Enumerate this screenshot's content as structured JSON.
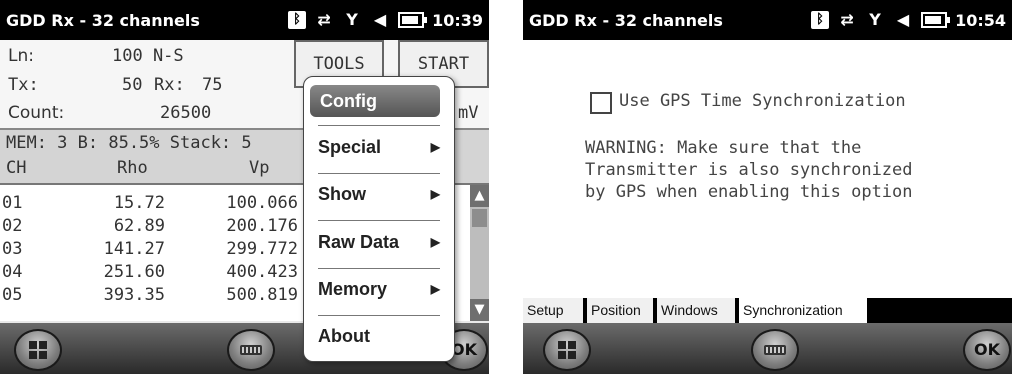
{
  "left": {
    "title": "GDD Rx - 32 channels",
    "time": "10:39",
    "icons": [
      "bluetooth-icon",
      "sync-icon",
      "no-signal-icon",
      "volume-icon",
      "battery-icon"
    ],
    "ln_label": "Ln:",
    "ln_value": "100 N-S",
    "tx_label": "Tx:",
    "tx_value": "50",
    "rx_label": "Rx:",
    "rx_value": "75",
    "count_label": "Count:",
    "count_value": "26500",
    "unit": "mV",
    "tools_button": "TOOLS",
    "start_button": "START",
    "stats_line": "MEM: 3 B: 85.5% Stack: 5",
    "col_ch": "CH",
    "col_rho": "Rho",
    "col_vp": "Vp",
    "rows": [
      {
        "ch": "01",
        "rho": "15.72",
        "vp": "100.066"
      },
      {
        "ch": "02",
        "rho": "62.89",
        "vp": "200.176"
      },
      {
        "ch": "03",
        "rho": "141.27",
        "vp": "299.772"
      },
      {
        "ch": "04",
        "rho": "251.60",
        "vp": "400.423"
      },
      {
        "ch": "05",
        "rho": "393.35",
        "vp": "500.819"
      }
    ],
    "menu": {
      "config": "Config",
      "special": "Special",
      "show": "Show",
      "raw_data": "Raw Data",
      "memory": "Memory",
      "about": "About"
    },
    "ok_label": "OK"
  },
  "right": {
    "title": "GDD Rx - 32 channels",
    "time": "10:54",
    "checkbox_label": "Use GPS Time Synchronization",
    "warning_lines": [
      "WARNING: Make sure that the",
      "Transmitter is also synchronized",
      "by GPS when enabling this option"
    ],
    "tabs": [
      "Setup",
      "Position",
      "Windows",
      "Synchronization"
    ],
    "active_tab": "Synchronization",
    "ok_label": "OK"
  }
}
